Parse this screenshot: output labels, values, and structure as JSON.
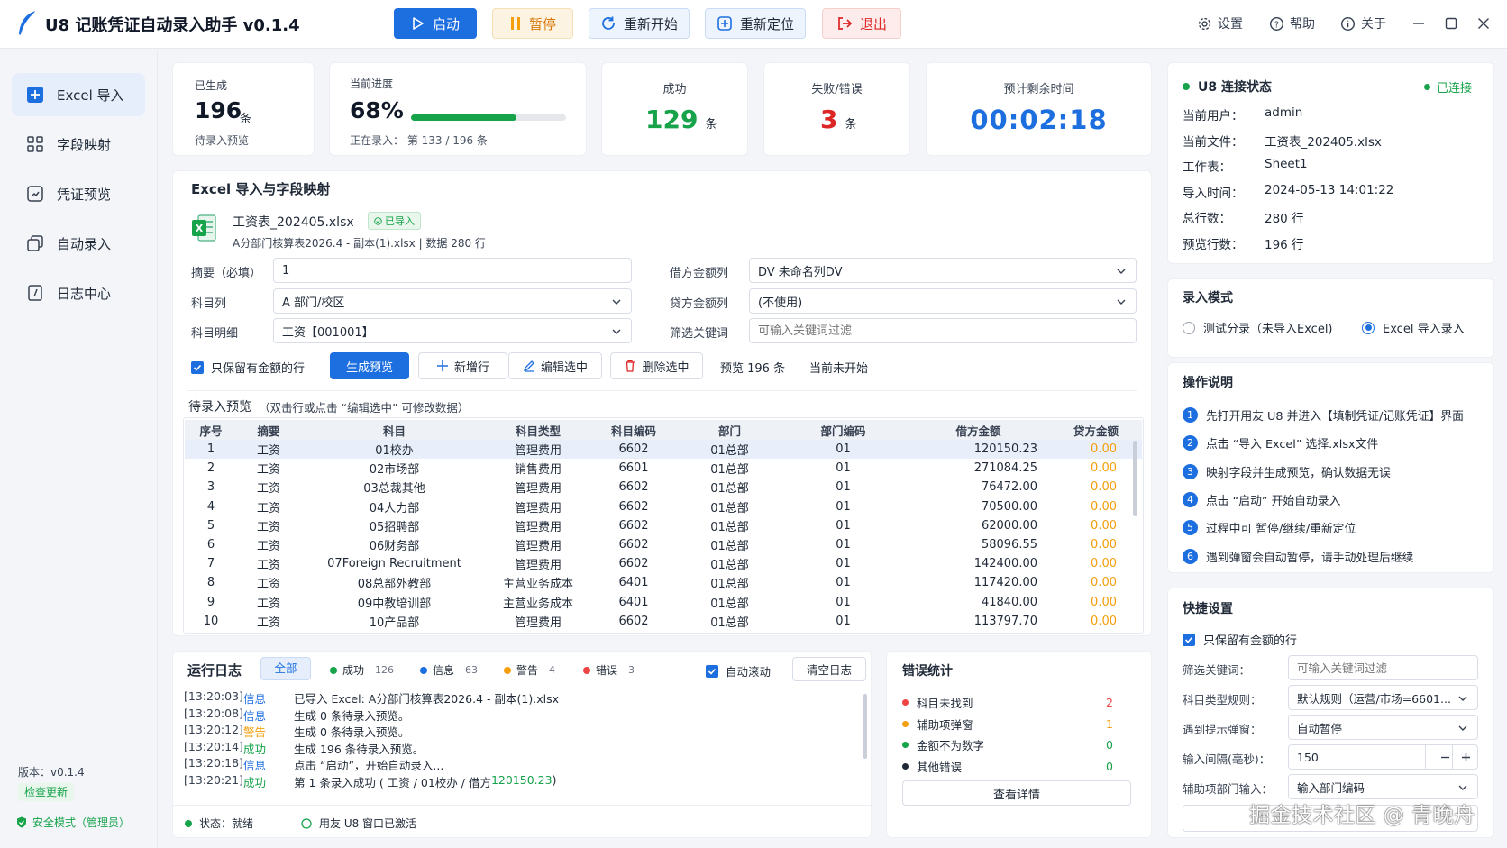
{
  "app": {
    "title": "U8 记账凭证自动录入助手 v0.1.4"
  },
  "toolbar": {
    "start": "启动",
    "pause": "暂停",
    "restart": "重新开始",
    "relocate": "重新定位",
    "exit": "退出",
    "settings": "设置",
    "help": "帮助",
    "about": "关于"
  },
  "colors": {
    "primary": "#1d6fe0",
    "success": "#16a34a",
    "error": "#dc2626",
    "warning": "#f59e0b",
    "progress": "#16a34a"
  },
  "sidebar": {
    "items": [
      {
        "label": "Excel 导入",
        "icon": "excel-import-icon",
        "active": true
      },
      {
        "label": "字段映射",
        "icon": "grid-icon"
      },
      {
        "label": "凭证预览",
        "icon": "preview-icon"
      },
      {
        "label": "自动录入",
        "icon": "auto-entry-icon"
      },
      {
        "label": "日志中心",
        "icon": "log-icon"
      }
    ],
    "version_label": "版本：v0.1.4",
    "check_update": "检查更新",
    "safe_mode": "安全模式（管理员）"
  },
  "stats": {
    "generated": {
      "label": "已生成",
      "value": "196",
      "unit": "条",
      "sub": "待录入预览"
    },
    "progress": {
      "label": "当前进度",
      "value": "68%",
      "fraction": 0.68,
      "sub": "正在录入： 第 133 / 196 条"
    },
    "success": {
      "label": "成功",
      "value": "129",
      "unit": "条"
    },
    "fail": {
      "label": "失败/错误",
      "value": "3",
      "unit": "条"
    },
    "remaining": {
      "label": "预计剩余时间",
      "value": "00:02:18"
    }
  },
  "import": {
    "section_title": "Excel 导入与字段映射",
    "file_name": "工资表_202405.xlsx",
    "imported_badge": "已导入",
    "file_meta": "A分部门核算表2026.4 - 副本(1).xlsx | 数据 280 行",
    "summary_label": "摘要（必填）",
    "summary_value": "1",
    "subject_col_label": "科目列",
    "subject_col_value": "A 部门/校区",
    "subject_detail_label": "科目明细",
    "subject_detail_value": "工资【001001】",
    "debit_label": "借方金额列",
    "debit_value": "DV 未命名列DV",
    "credit_label": "贷方金额列",
    "credit_value": "(不使用)",
    "filter_label": "筛选关键词",
    "filter_placeholder": "可输入关键词过滤",
    "keep_amount": "只保留有金额的行",
    "gen_preview": "生成预览",
    "add_row": "新增行",
    "edit_selected": "编辑选中",
    "delete_selected": "删除选中",
    "preview_count": "预览 196 条",
    "status_text": "当前未开始"
  },
  "preview": {
    "title": "待录入预览",
    "hint": "（双击行或点击 “编辑选中” 可修改数据）",
    "columns": [
      "序号",
      "摘要",
      "科目",
      "科目类型",
      "科目编码",
      "部门",
      "部门编码",
      "借方金额",
      "贷方金额"
    ],
    "rows": [
      [
        "1",
        "工资",
        "01校办",
        "管理费用",
        "6602",
        "01总部",
        "01",
        "120150.23",
        "0.00"
      ],
      [
        "2",
        "工资",
        "02市场部",
        "销售费用",
        "6601",
        "01总部",
        "01",
        "271084.25",
        "0.00"
      ],
      [
        "3",
        "工资",
        "03总裁其他",
        "管理费用",
        "6602",
        "01总部",
        "01",
        "76472.00",
        "0.00"
      ],
      [
        "4",
        "工资",
        "04人力部",
        "管理费用",
        "6602",
        "01总部",
        "01",
        "70500.00",
        "0.00"
      ],
      [
        "5",
        "工资",
        "05招聘部",
        "管理费用",
        "6602",
        "01总部",
        "01",
        "62000.00",
        "0.00"
      ],
      [
        "6",
        "工资",
        "06财务部",
        "管理费用",
        "6602",
        "01总部",
        "01",
        "58096.55",
        "0.00"
      ],
      [
        "7",
        "工资",
        "07Foreign Recruitment",
        "管理费用",
        "6602",
        "01总部",
        "01",
        "142400.00",
        "0.00"
      ],
      [
        "8",
        "工资",
        "08总部外教部",
        "主营业务成本",
        "6401",
        "01总部",
        "01",
        "117420.00",
        "0.00"
      ],
      [
        "9",
        "工资",
        "09中教培训部",
        "主营业务成本",
        "6401",
        "01总部",
        "01",
        "41840.00",
        "0.00"
      ],
      [
        "10",
        "工资",
        "10产品部",
        "管理费用",
        "6602",
        "01总部",
        "01",
        "113797.70",
        "0.00"
      ]
    ]
  },
  "log": {
    "title": "运行日志",
    "filter_all": "全部",
    "filters": [
      {
        "label": "成功",
        "count": "126",
        "color": "#16a34a"
      },
      {
        "label": "信息",
        "count": "63",
        "color": "#1d6fe0"
      },
      {
        "label": "警告",
        "count": "4",
        "color": "#f59e0b"
      },
      {
        "label": "错误",
        "count": "3",
        "color": "#ef4444"
      }
    ],
    "auto_scroll": "自动滚动",
    "clear": "清空日志",
    "lines": [
      {
        "time": "[13:20:03]",
        "level": "信息",
        "color": "#1d6fe0",
        "msg": "已导入 Excel: A分部门核算表2026.4 - 副本(1).xlsx"
      },
      {
        "time": "[13:20:08]",
        "level": "信息",
        "color": "#1d6fe0",
        "msg": "生成 0 条待录入预览。"
      },
      {
        "time": "[13:20:12]",
        "level": "警告",
        "color": "#f59e0b",
        "msg": "生成 0 条待录入预览。"
      },
      {
        "time": "[13:20:14]",
        "level": "成功",
        "color": "#16a34a",
        "msg": "生成 196 条待录入预览。"
      },
      {
        "time": "[13:20:18]",
        "level": "信息",
        "color": "#1d6fe0",
        "msg": "点击 “启动”，开始自动录入..."
      },
      {
        "time": "[13:20:21]",
        "level": "成功",
        "color": "#16a34a",
        "msg": "第 1 条录入成功 ( 工资 / 01校办 / 借方 ",
        "amount": "120150.23",
        "tail": ")"
      }
    ],
    "status_label": "状态：就绪",
    "u8_window": "用友 U8 窗口已激活"
  },
  "errors": {
    "title": "错误统计",
    "items": [
      {
        "label": "科目未找到",
        "count": "2",
        "color": "#ef4444"
      },
      {
        "label": "辅助项弹窗",
        "count": "1",
        "color": "#f59e0b"
      },
      {
        "label": "金额不为数字",
        "count": "0",
        "color": "#16a34a"
      },
      {
        "label": "其他错误",
        "count": "0",
        "color": "#1f2937"
      }
    ],
    "details": "查看详情"
  },
  "u8": {
    "title": "U8 连接状态",
    "status": "已连接",
    "fields": [
      {
        "k": "当前用户：",
        "v": "admin"
      },
      {
        "k": "当前文件：",
        "v": "工资表_202405.xlsx"
      },
      {
        "k": "工作表：",
        "v": "Sheet1"
      },
      {
        "k": "导入时间：",
        "v": "2024-05-13 14:01:22"
      },
      {
        "k": "总行数：",
        "v": "280 行"
      },
      {
        "k": "预览行数：",
        "v": "196 行"
      }
    ]
  },
  "mode": {
    "title": "录入模式",
    "test": "测试分录（未导入Excel)",
    "excel": "Excel 导入录入"
  },
  "instructions": {
    "title": "操作说明",
    "steps": [
      "先打开用友 U8 并进入【填制凭证/记账凭证】界面",
      "点击 “导入 Excel” 选择.xlsx文件",
      "映射字段并生成预览，确认数据无误",
      "点击 “启动” 开始自动录入",
      "过程中可 暂停/继续/重新定位",
      "遇到弹窗会自动暂停，请手动处理后继续"
    ]
  },
  "quick": {
    "title": "快捷设置",
    "keep_amount": "只保留有金额的行",
    "filter_label": "筛选关键词：",
    "filter_placeholder": "可输入关键词过滤",
    "type_rule_label": "科目类型规则：",
    "type_rule_value": "默认规则（运营/市场=6601...",
    "popup_label": "遇到提示弹窗：",
    "popup_value": "自动暂停",
    "interval_label": "输入间隔(毫秒)：",
    "interval_value": "150",
    "aux_label": "辅助项部门输入：",
    "aux_value": "输入部门编码"
  },
  "watermark": "掘金技术社区 @ 青晚舟"
}
